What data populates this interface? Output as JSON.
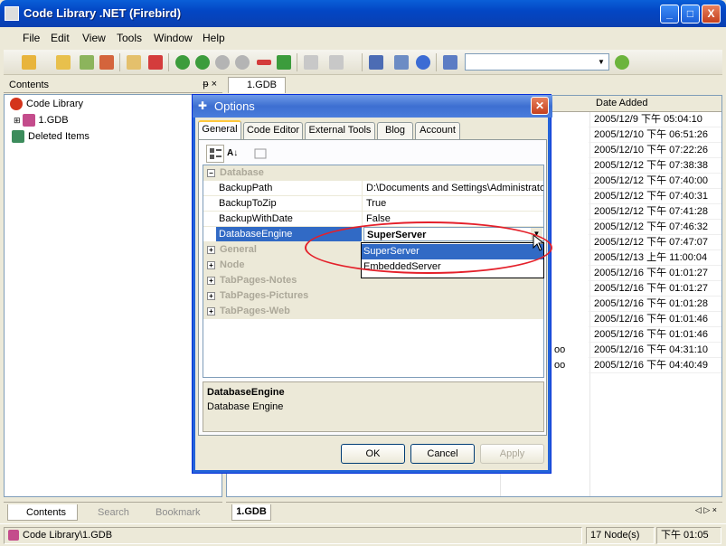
{
  "window": {
    "title": "Code Library .NET (Firebird)",
    "min": "_",
    "max": "□",
    "close": "X"
  },
  "menu": [
    "File",
    "Edit",
    "View",
    "Tools",
    "Window",
    "Help"
  ],
  "left_panel": {
    "header": "Contents",
    "pin": "ᵽ ×",
    "tree": [
      "Code Library",
      "1.GDB",
      "Deleted Items"
    ],
    "tabs": [
      "Contents",
      "Search",
      "Bookmark"
    ]
  },
  "doc": {
    "tab": "1.GDB",
    "grid_header": "Date Added",
    "rows": [
      "2005/12/9 下午 05:04:10",
      "2005/12/10 下午 06:51:26",
      "2005/12/10 下午 07:22:26",
      "2005/12/12 下午 07:38:38",
      "2005/12/12 下午 07:40:00",
      "2005/12/12 下午 07:40:31",
      "2005/12/12 下午 07:41:28",
      "2005/12/12 下午 07:46:32",
      "2005/12/12 下午 07:47:07",
      "2005/12/13 上午 11:00:04",
      "2005/12/16 下午 01:01:27",
      "2005/12/16 下午 01:01:27",
      "2005/12/16 下午 01:01:28",
      "2005/12/16 下午 01:01:46",
      "2005/12/16 下午 01:01:46",
      "2005/12/16 下午 04:31:10",
      "2005/12/16 下午 04:40:49"
    ],
    "left_fragments": [
      "oo",
      "oo"
    ],
    "bottom_tab": "1.GDB"
  },
  "status": {
    "path": "Code Library\\1.GDB",
    "nodes": "17 Node(s)",
    "time": "下午 01:05"
  },
  "dialog": {
    "title": "Options",
    "tabs": [
      "General",
      "Code Editor",
      "External Tools",
      "Blog",
      "Account"
    ],
    "categories": [
      "Database",
      "General",
      "Node",
      "TabPages-Notes",
      "TabPages-Pictures",
      "TabPages-Web"
    ],
    "properties": [
      {
        "name": "BackupPath",
        "value": "D:\\Documents and Settings\\Administrator"
      },
      {
        "name": "BackupToZip",
        "value": "True"
      },
      {
        "name": "BackupWithDate",
        "value": "False"
      },
      {
        "name": "DatabaseEngine",
        "value": "SuperServer"
      }
    ],
    "dropdown_options": [
      "SuperServer",
      "EmbeddedServer"
    ],
    "desc_title": "DatabaseEngine",
    "desc_text": "Database Engine",
    "buttons": {
      "ok": "OK",
      "cancel": "Cancel",
      "apply": "Apply"
    }
  }
}
